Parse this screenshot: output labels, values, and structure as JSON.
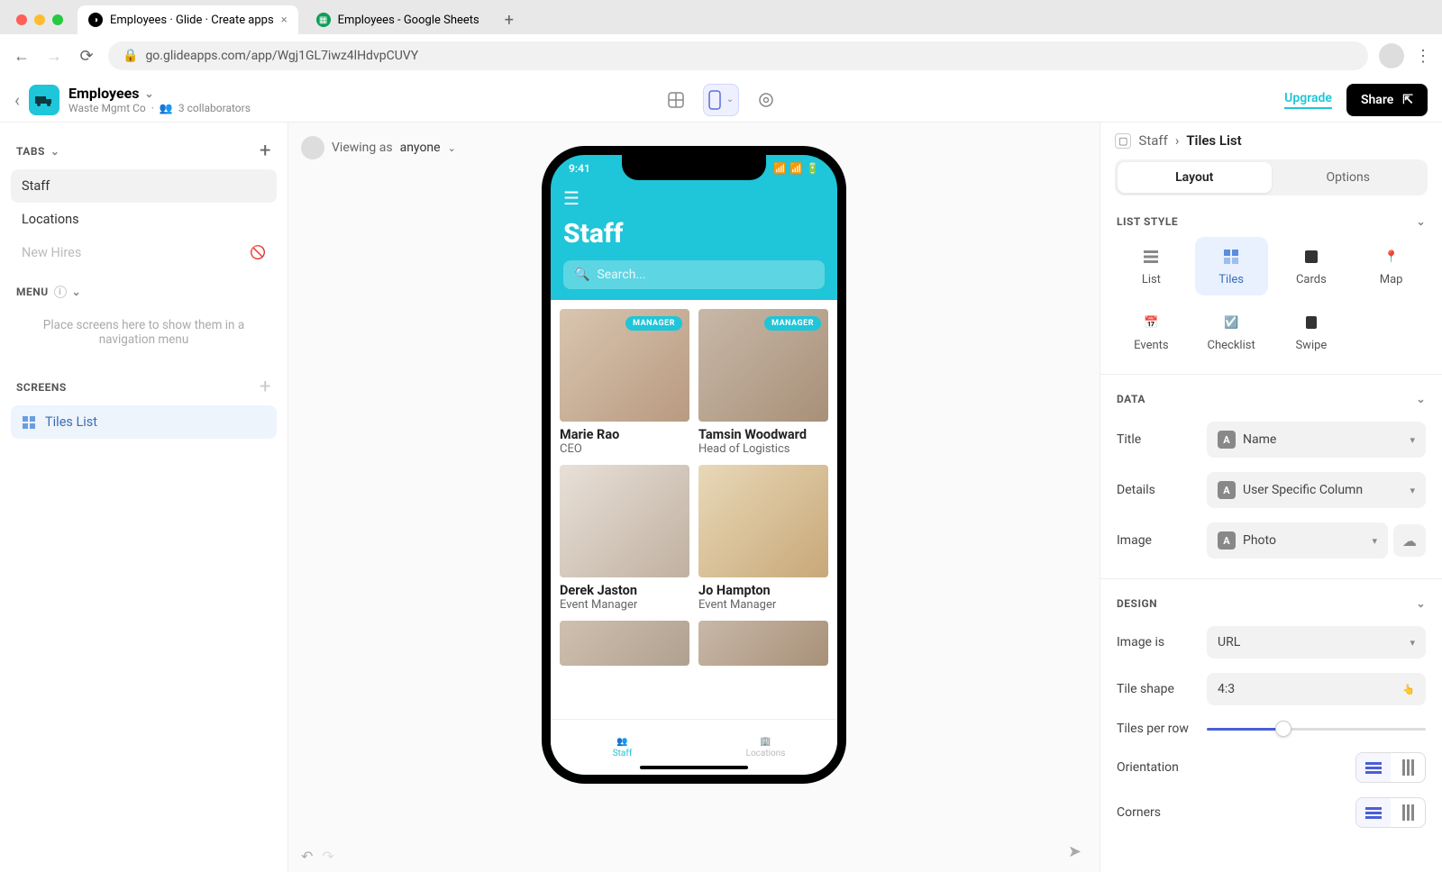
{
  "browser": {
    "tabs": [
      {
        "title": "Employees · Glide · Create apps",
        "active": true
      },
      {
        "title": "Employees - Google Sheets",
        "active": false
      }
    ],
    "url": "go.glideapps.com/app/Wgj1GL7iwz4lHdvpCUVY"
  },
  "app_header": {
    "back_visible": true,
    "title": "Employees",
    "org": "Waste Mgmt Co",
    "collaborators": "3 collaborators",
    "upgrade": "Upgrade",
    "share": "Share"
  },
  "left": {
    "tabs_header": "TABS",
    "tabs": [
      {
        "label": "Staff",
        "active": true,
        "hidden": false
      },
      {
        "label": "Locations",
        "active": false,
        "hidden": false
      },
      {
        "label": "New Hires",
        "active": false,
        "hidden": true
      }
    ],
    "menu_header": "MENU",
    "menu_placeholder": "Place screens here to show them in a navigation menu",
    "screens_header": "SCREENS",
    "screens": [
      {
        "label": "Tiles List",
        "active": true
      }
    ]
  },
  "center": {
    "viewing_as_label": "Viewing as",
    "viewing_as_value": "anyone",
    "phone": {
      "time": "9:41",
      "title": "Staff",
      "search_placeholder": "Search...",
      "tiles": [
        {
          "name": "Marie Rao",
          "role": "CEO",
          "badge": "MANAGER"
        },
        {
          "name": "Tamsin Woodward",
          "role": "Head of Logistics",
          "badge": "MANAGER"
        },
        {
          "name": "Derek Jaston",
          "role": "Event Manager",
          "badge": null
        },
        {
          "name": "Jo Hampton",
          "role": "Event Manager",
          "badge": null
        }
      ],
      "nav": [
        {
          "label": "Staff",
          "active": true
        },
        {
          "label": "Locations",
          "active": false
        }
      ]
    }
  },
  "right": {
    "breadcrumb": {
      "parent": "Staff",
      "current": "Tiles List"
    },
    "segments": {
      "layout": "Layout",
      "options": "Options",
      "active": "layout"
    },
    "sections": {
      "list_style": {
        "header": "LIST STYLE",
        "options": [
          "List",
          "Tiles",
          "Cards",
          "Map",
          "Events",
          "Checklist",
          "Swipe"
        ],
        "selected": "Tiles"
      },
      "data": {
        "header": "DATA",
        "rows": {
          "title": {
            "label": "Title",
            "value": "Name"
          },
          "details": {
            "label": "Details",
            "value": "User Specific Column"
          },
          "image": {
            "label": "Image",
            "value": "Photo"
          }
        }
      },
      "design": {
        "header": "DESIGN",
        "image_is": {
          "label": "Image is",
          "value": "URL"
        },
        "tile_shape": {
          "label": "Tile shape",
          "value": "4:3"
        },
        "tiles_per_row": {
          "label": "Tiles per row"
        },
        "orientation": {
          "label": "Orientation"
        },
        "corners": {
          "label": "Corners"
        }
      }
    }
  }
}
